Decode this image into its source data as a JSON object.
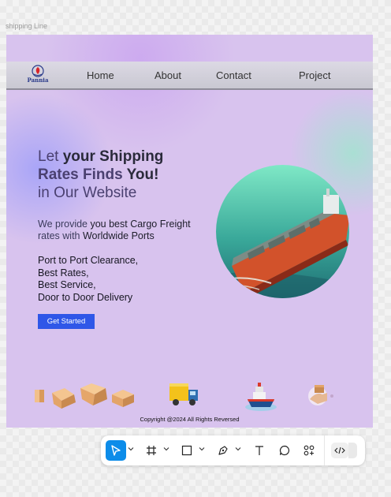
{
  "frame": {
    "label": "shipping Line"
  },
  "nav": {
    "logo_text": "Pannia",
    "links": [
      "Home",
      "About",
      "Contact",
      "Project"
    ]
  },
  "hero": {
    "line1_a": "Let ",
    "line1_b": "your Shipping",
    "line2_a": "Rates Finds",
    "line2_b": " You!",
    "line3": "in Our Website",
    "desc_a": "We provide ",
    "desc_b": "you best Cargo Freight",
    "desc_c": "rates with ",
    "desc_d": "Worldwide Ports",
    "list": [
      "Port to Port Clearance,",
      "Best Rates,",
      "Best Service,",
      "Door to Door Delivery"
    ],
    "cta_label": "Get Started"
  },
  "footer": {
    "copyright": "Copyright @2024 All Rights Reversed"
  },
  "colors": {
    "accent": "#2f57e8",
    "background": "#d8c3ee",
    "tool_active": "#0c8ce9"
  },
  "icons": [
    "boxes-icon",
    "truck-icon",
    "ship-icon",
    "delivery-hand-icon"
  ],
  "toolbar": {
    "tools": [
      "move-tool",
      "frame-tool",
      "shape-tool",
      "pen-tool",
      "text-tool",
      "comment-tool",
      "actions-tool",
      "dev-mode-toggle"
    ]
  }
}
